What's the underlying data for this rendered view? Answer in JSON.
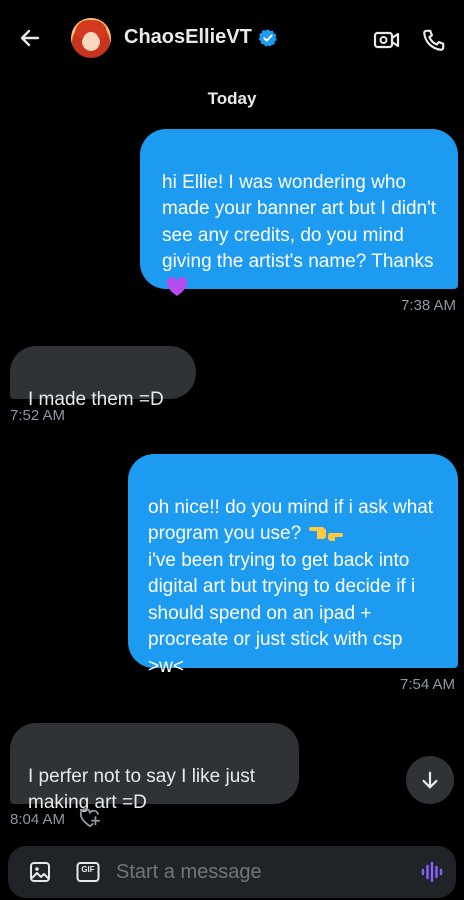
{
  "header": {
    "contact_name": "ChaosEllieVT",
    "icons": {
      "back": "arrow-left-icon",
      "verified": "verified-badge-icon",
      "video": "video-call-icon",
      "call": "phone-icon"
    }
  },
  "date_separator": "Today",
  "messages": [
    {
      "direction": "sent",
      "text": "hi Ellie! I was wondering who made your banner art but I didn't see any credits, do you mind giving the artist's name? Thanks",
      "emoji": "purple-heart",
      "time": "7:38 AM"
    },
    {
      "direction": "received",
      "text": "I made them =D",
      "time": "7:52 AM"
    },
    {
      "direction": "sent",
      "text_line1": "oh nice!! do you mind if i ask what program you use?",
      "emoji": "backhand-index-pointing-left-right",
      "text_line2": "i've been trying to get back into digital art but trying to decide if i should spend on an ipad + procreate or just stick with csp >w<",
      "time": "7:54 AM"
    },
    {
      "direction": "received",
      "text": "I perfer not to say I like just making art =D",
      "time": "8:04 AM",
      "reaction_icon": "heart-plus-icon"
    }
  ],
  "composer": {
    "placeholder": "Start a message",
    "gif_label": "GIF",
    "icons": {
      "image": "image-icon",
      "gif": "gif-icon",
      "voice": "voice-message-icon"
    }
  },
  "scroll_button_icon": "arrow-down-icon",
  "colors": {
    "sent_bubble": "#1d9bf0",
    "received_bubble": "#2f3336",
    "background": "#000000",
    "accent_voice": "#8a63ff"
  }
}
